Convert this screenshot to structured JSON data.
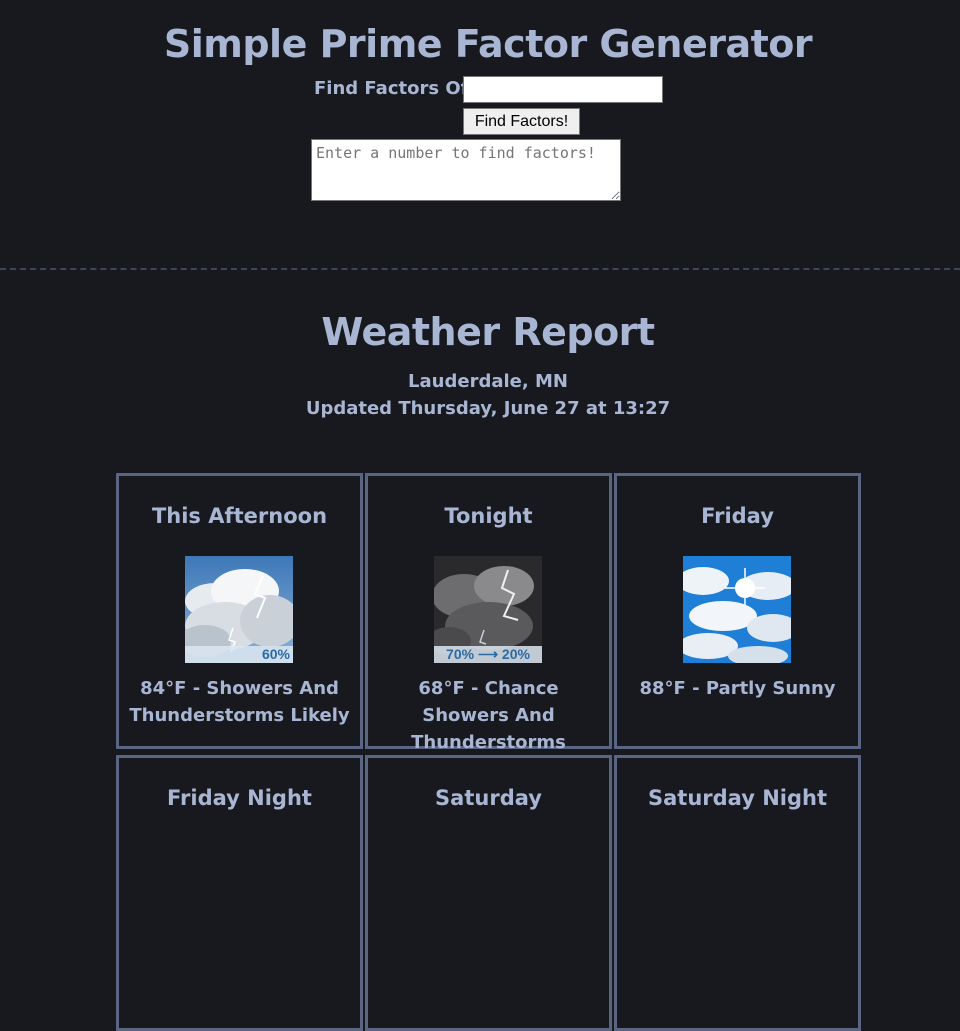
{
  "prime": {
    "title": "Simple Prime Factor Generator",
    "find_label": "Find Factors Of:",
    "input_value": "",
    "button_label": "Find Factors!",
    "result_placeholder": "Enter a number to find factors!"
  },
  "weather": {
    "title": "Weather Report",
    "location": "Lauderdale, MN",
    "updated": "Updated Thursday, June 27 at 13:27",
    "periods": [
      {
        "name": "This Afternoon",
        "icon": "thunderstorm-icon",
        "pop": "60%",
        "desc": "84°F - Showers And Thunderstorms Likely"
      },
      {
        "name": "Tonight",
        "icon": "night-thunderstorm-icon",
        "pop": "70% ⟶ 20%",
        "desc": "68°F - Chance Showers And Thunderstorms"
      },
      {
        "name": "Friday",
        "icon": "partly-sunny-icon",
        "pop": "",
        "desc": "88°F - Partly Sunny"
      },
      {
        "name": "Friday Night",
        "icon": "",
        "pop": "",
        "desc": ""
      },
      {
        "name": "Saturday",
        "icon": "",
        "pop": "",
        "desc": ""
      },
      {
        "name": "Saturday Night",
        "icon": "",
        "pop": "",
        "desc": ""
      }
    ]
  },
  "colors": {
    "background": "#18191e",
    "text": "#a9b6d3",
    "card_border": "#5a6583"
  }
}
